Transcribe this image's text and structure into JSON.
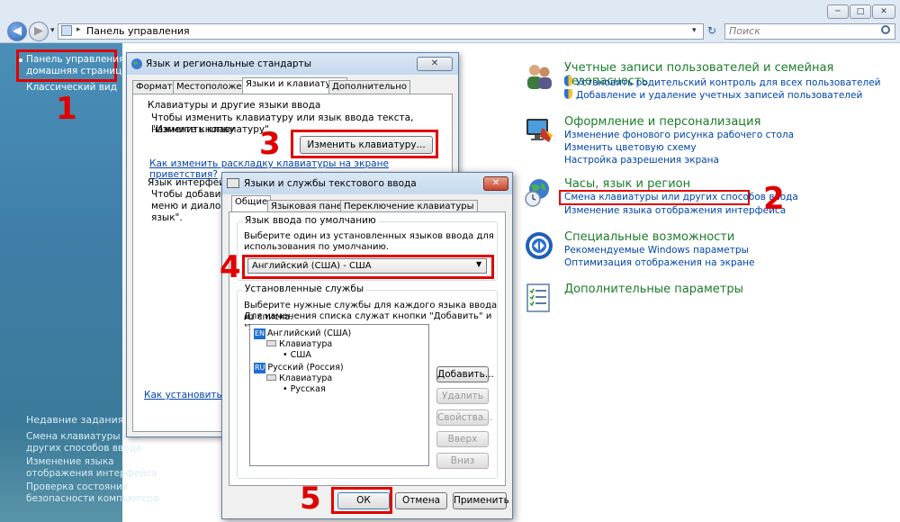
{
  "explorer": {
    "address": "Панель управления",
    "search_placeholder": "Поиск",
    "back_arrow": "◀",
    "forward_arrow": "▶",
    "dropdown_arrow": "▾",
    "caption_minimize": "─",
    "caption_maximize": "□",
    "caption_close": "✕",
    "refresh": "↻",
    "breadcrumb_sep": "▸"
  },
  "sidebar": {
    "home_line1": "Панель управления -",
    "home_line2": "домашняя страница",
    "classic_view": "Классический вид",
    "recent_heading": "Недавние задания",
    "recent": [
      {
        "line1": "Смена клавиатуры или",
        "line2": "других способов ввода"
      },
      {
        "line1": "Изменение языка",
        "line2": "отображения интерфейса"
      },
      {
        "line1": "Проверка состояния",
        "line2": "безопасности компьютера"
      }
    ]
  },
  "categories": [
    {
      "title": "Учетные записи пользователей и семейная безопасность",
      "icon": "users-icon",
      "links": [
        "Установить родительский контроль для всех пользователей",
        "Добавление и удаление учетных записей пользователей"
      ]
    },
    {
      "title": "Оформление и персонализация",
      "icon": "monitor-icon",
      "links": [
        "Изменение фонового рисунка рабочего стола",
        "Изменить цветовую схему",
        "Настройка разрешения экрана"
      ]
    },
    {
      "title": "Часы, язык и регион",
      "icon": "globe-clock-icon",
      "links": [
        "Смена клавиатуры или других способов ввода",
        "Изменение языка отображения интерфейса"
      ]
    },
    {
      "title": "Специальные возможности",
      "icon": "accessibility-icon",
      "links": [
        "Рекомендуемые Windows параметры",
        "Оптимизация отображения на экране"
      ]
    },
    {
      "title": "Дополнительные параметры",
      "icon": "checklist-icon",
      "links": []
    }
  ],
  "annotations": {
    "n1": "1",
    "n2": "2",
    "n3": "3",
    "n4": "4",
    "n5": "5"
  },
  "dialog1": {
    "title": "Язык и региональные стандарты",
    "close": "✕",
    "tabs": [
      "Форматы",
      "Местоположение",
      "Языки и клавиатуры",
      "Дополнительно"
    ],
    "group1_label": "Клавиатуры и другие языки ввода",
    "group1_text1": "Чтобы изменить клавиатуру или язык ввода текста, нажмите кнопку",
    "group1_text2": "\"Изменить клавиатуру\".",
    "change_keyboard_button": "Изменить клавиатуру...",
    "welcome_link": "Как изменить раскладку клавиатуры на экране приветствия?",
    "group2_label": "Язык интерфейса",
    "group2_text1": "Чтобы добавить и",
    "group2_text2": "меню и диалого",
    "group2_text3": "язык\".",
    "bottom_link": "Как установить допо"
  },
  "dialog2": {
    "title": "Языки и службы текстового ввода",
    "close": "✕",
    "tabs": [
      "Общие",
      "Языковая панель",
      "Переключение клавиатуры"
    ],
    "default_lang_label": "Язык ввода по умолчанию",
    "default_lang_text1": "Выберите один из установленных языков ввода для",
    "default_lang_text2": "использования по умолчанию.",
    "default_lang_value": "Английский (США) - США",
    "select_arrow": "▼",
    "installed_label": "Установленные службы",
    "installed_text1": "Выберите нужные службы для каждого языка ввода из списка.",
    "installed_text2": "Для изменения списка служат кнопки \"Добавить\" и \"Удалить\".",
    "tree": [
      {
        "badge": "EN",
        "language": "Английский (США)",
        "group": "Клавиатура",
        "item": "США"
      },
      {
        "badge": "RU",
        "language": "Русский (Россия)",
        "group": "Клавиатура",
        "item": "Русская"
      }
    ],
    "buttons": {
      "add": "Добавить...",
      "remove": "Удалить",
      "properties": "Свойства...",
      "up": "Вверх",
      "down": "Вниз"
    },
    "footer": {
      "ok": "ОК",
      "cancel": "Отмена",
      "apply": "Применить"
    }
  }
}
